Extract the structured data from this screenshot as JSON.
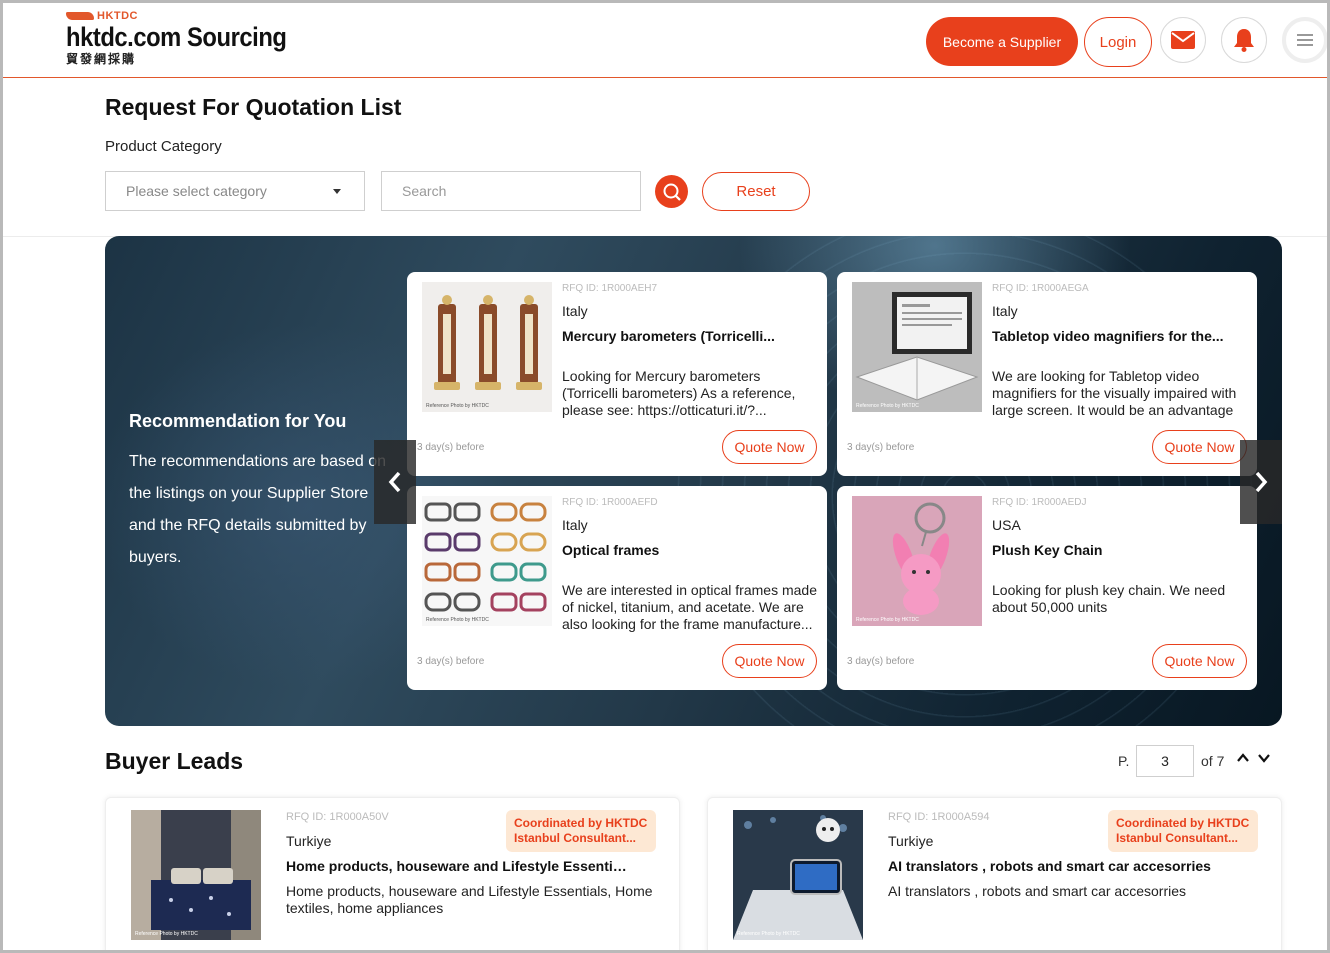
{
  "header": {
    "logo_top": "HKTDC",
    "logo_main": "hktdc.com Sourcing",
    "logo_sub": "貿發網採購",
    "become_supplier": "Become a Supplier",
    "login": "Login"
  },
  "filters": {
    "page_title": "Request For Quotation List",
    "category_label": "Product Category",
    "category_placeholder": "Please select category",
    "search_placeholder": "Search",
    "reset_label": "Reset"
  },
  "recommendation": {
    "title": "Recommendation for You",
    "text": "The recommendations are based on the listings on your Supplier Store and the RFQ details submitted by buyers.",
    "cards": [
      {
        "rfq_id": "RFQ ID: 1R000AEH7",
        "country": "Italy",
        "title": "Mercury barometers (Torricelli...",
        "description": "Looking for Mercury barometers (Torricelli barometers) As a reference, please see: https://otticaturi.it/?...",
        "ago": "3 day(s) before",
        "quote": "Quote Now",
        "credit": "Reference Photo by HKTDC"
      },
      {
        "rfq_id": "RFQ ID: 1R000AEGA",
        "country": "Italy",
        "title": "Tabletop video magnifiers for the...",
        "description": "We are looking for Tabletop video magnifiers for the visually impaired with large screen. It would be an advantage i...",
        "ago": "3 day(s) before",
        "quote": "Quote Now",
        "credit": "Reference Photo by HKTDC"
      },
      {
        "rfq_id": "RFQ ID: 1R000AEFD",
        "country": "Italy",
        "title": "Optical frames",
        "description": "We are interested in optical frames made of nickel, titanium, and acetate. We are also looking for the frame manufacture...",
        "ago": "3 day(s) before",
        "quote": "Quote Now",
        "credit": "Reference Photo by HKTDC"
      },
      {
        "rfq_id": "RFQ ID: 1R000AEDJ",
        "country": "USA",
        "title": "Plush Key Chain",
        "description": "Looking for plush key chain. We need about 50,000 units",
        "ago": "3 day(s) before",
        "quote": "Quote Now",
        "credit": "Reference Photo by HKTDC"
      }
    ]
  },
  "buyer_leads": {
    "title": "Buyer Leads",
    "pager": {
      "prefix": "P.",
      "current": "3",
      "total": "of 7"
    },
    "items": [
      {
        "rfq_id": "RFQ ID: 1R000A50V",
        "country": "Turkiye",
        "title": "Home products, houseware and Lifestyle Essentials,...",
        "description": "Home products, houseware and Lifestyle Essentials, Home textiles, home appliances",
        "badge_line1": "Coordinated by HKTDC",
        "badge_line2": "Istanbul Consultant...",
        "credit": "Reference Photo by HKTDC"
      },
      {
        "rfq_id": "RFQ ID: 1R000A594",
        "country": "Turkiye",
        "title": "AI translators , robots and smart car accesorries",
        "description": "AI translators , robots and smart car accesorries",
        "badge_line1": "Coordinated by HKTDC",
        "badge_line2": "Istanbul Consultant...",
        "credit": "Reference Photo by HKTDC"
      }
    ]
  },
  "colors": {
    "accent": "#e8401c",
    "badge_bg": "#fde8d4"
  }
}
